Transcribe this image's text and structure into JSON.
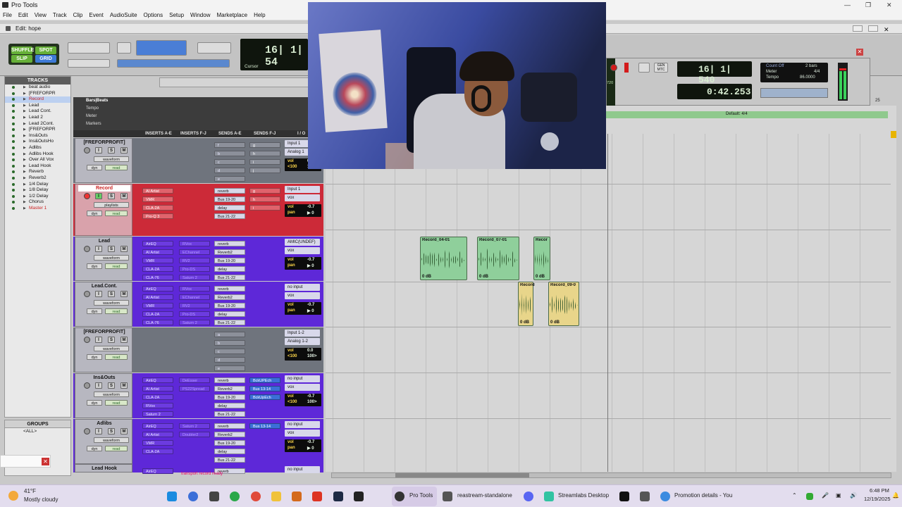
{
  "window": {
    "title": "Pro Tools",
    "edit_title": "Edit: hope"
  },
  "menu": [
    "File",
    "Edit",
    "View",
    "Track",
    "Clip",
    "Event",
    "AudioSuite",
    "Options",
    "Setup",
    "Window",
    "Marketplace",
    "Help"
  ],
  "modes": {
    "shuffle": "SHUFFLE",
    "spot": "SPOT",
    "slip": "SLIP",
    "grid": "GRID"
  },
  "counters": {
    "main": "16| 1| 54",
    "cursor_label": "Cursor",
    "main_right": "16| 1| 540",
    "secondary": "0:42.253",
    "side_small": "720",
    "gen": "GEN\nMTC"
  },
  "count_panel": {
    "count_off": "Count Off",
    "bars": "2 bars",
    "meter": "Meter",
    "meter_val": "4/4",
    "tempo": "Tempo",
    "tempo_val": "86.0000",
    "default_meter": "Default: 4/4",
    "ruler_25": "25"
  },
  "tracks_panel": {
    "header": "TRACKS",
    "items": [
      "beat audio",
      "[FREFORPR",
      "Record",
      "Lead",
      "Lead Cont.",
      "Lead 2",
      "Lead 2Cont.",
      "[FREFORPR",
      "Ins&Outs",
      "Ins&OutsHo",
      "Adlibs",
      "Adlibs Hook",
      "Over All Vox",
      "Lead Hook",
      "Reverb",
      "Reverb2",
      "1/4 Delay",
      "1/8 Delay",
      "1/2 Delay",
      "Chorus",
      "Master 1"
    ]
  },
  "groups_panel": {
    "header": "GROUPS",
    "item": "<ALL>"
  },
  "rulers": [
    "Bars|Beats",
    "Tempo",
    "Meter",
    "Markers"
  ],
  "columns": [
    "INSERTS A-E",
    "INSERTS F-J",
    "SENDS A-E",
    "SENDS F-J",
    "I / O"
  ],
  "track_rows": [
    {
      "name": "[FREFORPROFIT]",
      "view": "waveform",
      "dyn": "dyn",
      "auto": "read",
      "ins1": [],
      "ins2": [],
      "sends": [
        "f",
        "b",
        "c",
        "d",
        "e"
      ],
      "sends2": [
        "g",
        "h",
        "i",
        "j"
      ],
      "io_in": "Input 1",
      "io_out": "Analog 1",
      "vol": "vol",
      "vol_val": "0.0",
      "pan": "<100",
      "pan_val": "100>"
    },
    {
      "name": "Record",
      "view": "playlists",
      "dyn": "dyn",
      "auto": "read",
      "ins1": [
        "AI Artist",
        "VMR",
        "CLA-2A",
        "Pro-Q 3"
      ],
      "ins2": [],
      "sends": [
        "reverb",
        "Bus 19-20",
        "delay",
        "Bus 21-22"
      ],
      "sends2": [
        "g",
        "h",
        "i"
      ],
      "io_in": "Input 1",
      "io_out": "vox",
      "vol": "vol",
      "vol_val": "-0.7",
      "pan": "pan",
      "pan_val": "▶ 0"
    },
    {
      "name": "Lead",
      "view": "waveform",
      "dyn": "dyn",
      "auto": "read",
      "ins1": [
        "AirEQ",
        "AI Artist",
        "VMR",
        "CLA-2A",
        "CLA-76"
      ],
      "ins2": [
        "RVox",
        "EChannel",
        "RV2",
        "Pro-DS",
        "Saturn 2"
      ],
      "sends": [
        "reverb",
        "Reverb2",
        "Bus 19-20",
        "delay",
        "Bus 21-22"
      ],
      "sends2": [],
      "io_in": "AMIC(UNDEF)",
      "io_out": "vox",
      "vol": "vol",
      "vol_val": "-0.7",
      "pan": "pan",
      "pan_val": "▶ 0"
    },
    {
      "name": "Lead.Cont.",
      "view": "waveform",
      "dyn": "dyn",
      "auto": "read",
      "ins1": [
        "AirEQ",
        "AI Artist",
        "VMR",
        "CLA-2A",
        "CLA-76"
      ],
      "ins2": [
        "RVox",
        "EChannel",
        "RV2",
        "Pro-DS",
        "Saturn 2"
      ],
      "sends": [
        "reverb",
        "Reverb2",
        "Bus 19-20",
        "delay",
        "Bus 21-22"
      ],
      "sends2": [],
      "io_in": "no input",
      "io_out": "vox",
      "vol": "vol",
      "vol_val": "-0.7",
      "pan": "pan",
      "pan_val": "▶ 0"
    },
    {
      "name": "[FREFORPROFIT]",
      "view": "waveform",
      "dyn": "dyn",
      "auto": "read",
      "ins1": [],
      "ins2": [],
      "sends": [
        "a",
        "b",
        "c",
        "d",
        "e"
      ],
      "sends2": [],
      "io_in": "Input 1-2",
      "io_out": "Analog 1-2",
      "vol": "vol",
      "vol_val": "0.0",
      "pan": "<100",
      "pan_val": "100>"
    },
    {
      "name": "Ins&Outs",
      "view": "waveform",
      "dyn": "dyn",
      "auto": "read",
      "ins1": [
        "AirEQ",
        "AI Artist",
        "CLA-2A",
        "RVox",
        "Saturn 2"
      ],
      "ins2": [
        "DeEsser",
        "PS22Spread"
      ],
      "sends": [
        "reverb",
        "Reverb2",
        "Bus 19-20",
        "delay",
        "Bus 21-22"
      ],
      "sends2": [
        "BckUPEch",
        "Bus 13-14",
        "BckUpEch"
      ],
      "io_in": "no input",
      "io_out": "vox",
      "vol": "vol",
      "vol_val": "-0.7",
      "pan": "<100",
      "pan_val": "100>"
    },
    {
      "name": "Adlibs",
      "view": "waveform",
      "dyn": "dyn",
      "auto": "read",
      "ins1": [
        "AirEQ",
        "AI Artist",
        "VMR",
        "CLA-2A"
      ],
      "ins2": [
        "Saturn 2",
        "Doubler2"
      ],
      "sends": [
        "reverb",
        "Reverb2",
        "Bus 19-20",
        "delay",
        "Bus 21-22"
      ],
      "sends2": [
        "Bus 13-14"
      ],
      "io_in": "no input",
      "io_out": "vox",
      "vol": "vol",
      "vol_val": "-0.7",
      "pan": "pan",
      "pan_val": "▶ 0"
    },
    {
      "name": "Lead Hook",
      "view": "",
      "dyn": "",
      "auto": "",
      "ins1": [
        "AirEQ"
      ],
      "ins2": [],
      "sends": [
        "reverb"
      ],
      "sends2": [],
      "io_in": "no input",
      "io_out": "",
      "vol": "",
      "vol_val": "",
      "pan": "",
      "pan_val": ""
    }
  ],
  "clips": [
    {
      "name": "Record_04-01",
      "db": "0 dB",
      "color": "#8fcf9b"
    },
    {
      "name": "Record_07-01",
      "db": "0 dB",
      "color": "#8fcf9b"
    },
    {
      "name": "Recor",
      "db": "0 dB",
      "color": "#8fcf9b"
    },
    {
      "name": "Record",
      "db": "0 dB",
      "color": "#e8d58a"
    },
    {
      "name": "Record_09-0",
      "db": "0 dB",
      "color": "#e8d58a"
    }
  ],
  "status": {
    "transport": "transport record ready"
  },
  "taskbar": {
    "weather_temp": "41°F",
    "weather_desc": "Mostly cloudy",
    "apps": [
      {
        "label": "Pro Tools"
      },
      {
        "label": "reastream-standalone"
      },
      {
        "label": "Streamlabs Desktop"
      },
      {
        "label": "Promotion details - You"
      }
    ],
    "time": "6:48 PM",
    "date": "12/19/2025"
  },
  "colors": {
    "record_track": "#cc2a38",
    "lead_track": "#5e28d8",
    "gray_track": "#7a7f8a",
    "clip_green": "#8fcf9b",
    "clip_yellow": "#e8d58a",
    "taskbar": "#e3ddee"
  }
}
